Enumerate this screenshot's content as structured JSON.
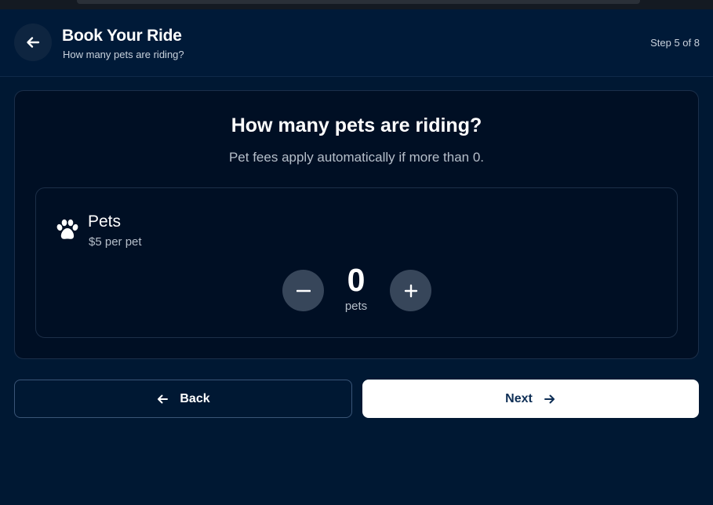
{
  "header": {
    "title": "Book Your Ride",
    "subtitle": "How many pets are riding?",
    "step": "Step 5 of 8",
    "back_icon": "arrow-left-icon"
  },
  "question": {
    "title": "How many pets are riding?",
    "subtitle": "Pet fees apply automatically if more than 0."
  },
  "pets": {
    "icon": "paw-icon",
    "label": "Pets",
    "price": "$5 per pet",
    "count": "0",
    "unit": "pets",
    "decrement_icon": "minus-icon",
    "increment_icon": "plus-icon"
  },
  "footer": {
    "back_label": "Back",
    "next_label": "Next",
    "back_icon": "arrow-left-icon",
    "next_icon": "arrow-right-icon"
  },
  "colors": {
    "background": "#001833",
    "card": "#000f24",
    "stepper": "#37465a",
    "next_button": "#ffffff",
    "next_text": "#0e2e55"
  }
}
